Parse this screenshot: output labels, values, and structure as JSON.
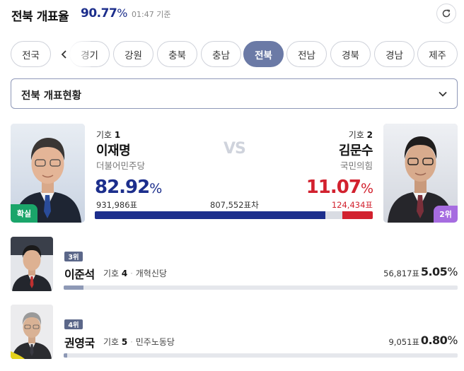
{
  "header": {
    "title": "전북 개표율",
    "rate_value": "90.77",
    "rate_unit": "%",
    "time": "01:47 기준",
    "refresh_icon": "refresh-icon"
  },
  "tabs": [
    {
      "label": "전국",
      "active": false
    },
    {
      "label": "경기",
      "active": false
    },
    {
      "label": "강원",
      "active": false
    },
    {
      "label": "충북",
      "active": false
    },
    {
      "label": "충남",
      "active": false
    },
    {
      "label": "전북",
      "active": true
    },
    {
      "label": "전남",
      "active": false
    },
    {
      "label": "경북",
      "active": false
    },
    {
      "label": "경남",
      "active": false
    },
    {
      "label": "제주",
      "active": false
    }
  ],
  "dropdown": {
    "label": "전북 개표현황"
  },
  "matchup": {
    "vs": "VS",
    "difference": "807,552표차",
    "candidate1": {
      "number_prefix": "기호",
      "number": "1",
      "name": "이재명",
      "party": "더불어민주당",
      "pct": "82.92",
      "pct_unit": "%",
      "votes": "931,986표",
      "status": "확실",
      "share": 0.8292,
      "color": "#1c2e8c"
    },
    "candidate2": {
      "number_prefix": "기호",
      "number": "2",
      "name": "김문수",
      "party": "국민의힘",
      "pct": "11.07",
      "pct_unit": "%",
      "votes": "124,434표",
      "rank": "2위",
      "share": 0.1107,
      "color": "#d2212e"
    },
    "other_color": "#d9dce3"
  },
  "others": [
    {
      "rank": "3위",
      "name": "이준석",
      "number_prefix": "기호",
      "number": "4",
      "party": "개혁신당",
      "votes": "56,817표",
      "pct": "5.05",
      "pct_unit": "%",
      "share": 0.0505
    },
    {
      "rank": "4위",
      "name": "권영국",
      "number_prefix": "기호",
      "number": "5",
      "party": "민주노동당",
      "votes": "9,051표",
      "pct": "0.80",
      "pct_unit": "%",
      "share": 0.008
    }
  ]
}
